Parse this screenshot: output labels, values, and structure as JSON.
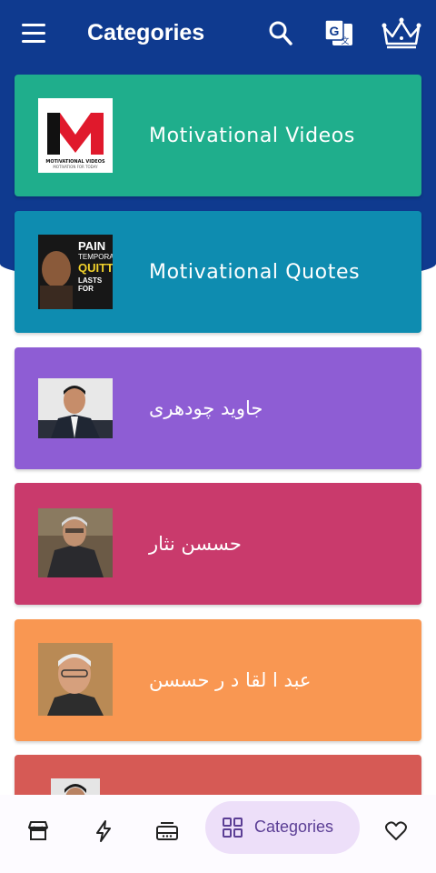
{
  "header": {
    "title": "Categories",
    "icons": [
      "menu-icon",
      "search-icon",
      "translate-icon",
      "crown-icon"
    ],
    "background_color": "#0f3a8f"
  },
  "categories": [
    {
      "label": "Motivational Videos",
      "color": "#1fae8c",
      "thumb_text": [
        "MOTIVATIONAL VIDEOS",
        "MOTIVATION FOR TODAY"
      ]
    },
    {
      "label": "Motivational Quotes",
      "color": "#0e8cb0",
      "thumb_text": [
        "PAIN",
        "TEMPORA",
        "QUITTI",
        "LASTS FOR"
      ]
    },
    {
      "label": "جاوید چودھری",
      "color": "#8e5dd4"
    },
    {
      "label": "حسسن نثار",
      "color": "#c93a6c"
    },
    {
      "label": "عبد ا لقا د ر حسسن",
      "color": "#f99752"
    },
    {
      "label": "",
      "color": "#d65a55"
    }
  ],
  "bottom_nav": {
    "items": [
      "store-icon",
      "flash-icon",
      "inbox-icon",
      "categories-icon",
      "favorites-icon"
    ],
    "active_label": "Categories",
    "active_color": "#eddff9"
  }
}
